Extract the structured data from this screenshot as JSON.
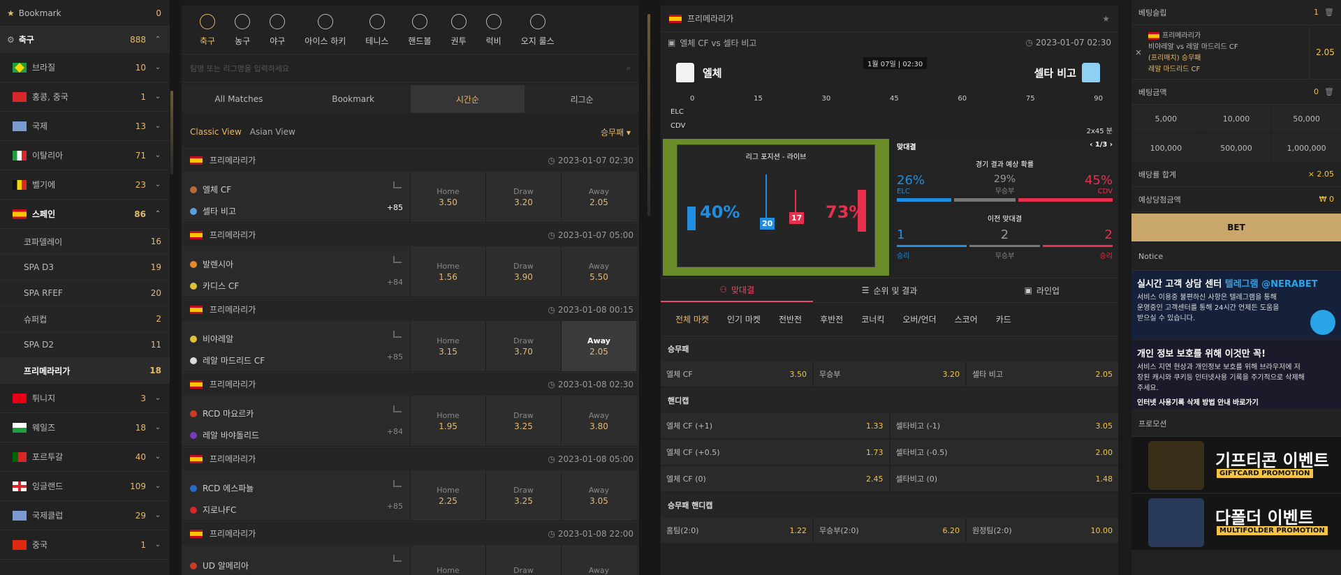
{
  "sidebar": {
    "bookmark": {
      "label": "Bookmark",
      "count": "0"
    },
    "soccer": {
      "label": "축구",
      "count": "888"
    },
    "countries": [
      {
        "label": "브라질",
        "count": "10"
      },
      {
        "label": "홍콩, 중국",
        "count": "1"
      },
      {
        "label": "국제",
        "count": "13"
      },
      {
        "label": "이탈리아",
        "count": "71"
      },
      {
        "label": "벨기에",
        "count": "23"
      },
      {
        "label": "스페인",
        "count": "86"
      }
    ],
    "spain_leagues": [
      {
        "label": "코파델레이",
        "count": "16"
      },
      {
        "label": "SPA D3",
        "count": "19"
      },
      {
        "label": "SPA RFEF",
        "count": "20"
      },
      {
        "label": "슈퍼컵",
        "count": "2"
      },
      {
        "label": "SPA D2",
        "count": "11"
      },
      {
        "label": "프리메라리가",
        "count": "18"
      }
    ],
    "countries2": [
      {
        "label": "튀니지",
        "count": "3"
      },
      {
        "label": "웨일즈",
        "count": "18"
      },
      {
        "label": "포르투갈",
        "count": "40"
      },
      {
        "label": "잉글랜드",
        "count": "109"
      },
      {
        "label": "국제클럽",
        "count": "29"
      },
      {
        "label": "중국",
        "count": "1"
      }
    ]
  },
  "sports": [
    "축구",
    "농구",
    "야구",
    "아이스 하키",
    "테니스",
    "핸드볼",
    "권투",
    "럭비",
    "오지 룰스"
  ],
  "search": {
    "placeholder": "팀명 또는 리그명을 입력하세요"
  },
  "tabs": [
    "All Matches",
    "Bookmark",
    "시간순",
    "리그순"
  ],
  "view": {
    "classic": "Classic View",
    "asian": "Asian View",
    "market": "승무패"
  },
  "odds_labels": {
    "home": "Home",
    "draw": "Draw",
    "away": "Away"
  },
  "matches": [
    {
      "league": "프리메라리가",
      "date": "2023-01-07 02:30",
      "home": "엘체 CF",
      "away": "셀타 비고",
      "more": "+85",
      "h": "3.50",
      "d": "3.20",
      "a": "2.05"
    },
    {
      "league": "프리메라리가",
      "date": "2023-01-07 05:00",
      "home": "발렌시아",
      "away": "카디스 CF",
      "more": "+84",
      "h": "1.56",
      "d": "3.90",
      "a": "5.50"
    },
    {
      "league": "프리메라리가",
      "date": "2023-01-08 00:15",
      "home": "비야레알",
      "away": "레알 마드리드 CF",
      "more": "+85",
      "h": "3.15",
      "d": "3.70",
      "a": "2.05"
    },
    {
      "league": "프리메라리가",
      "date": "2023-01-08 02:30",
      "home": "RCD 마요르카",
      "away": "레알 바야돌리드",
      "more": "+84",
      "h": "1.95",
      "d": "3.25",
      "a": "3.80"
    },
    {
      "league": "프리메라리가",
      "date": "2023-01-08 05:00",
      "home": "RCD 에스파뇰",
      "away": "지로나FC",
      "more": "+85",
      "h": "2.25",
      "d": "3.25",
      "a": "3.05"
    },
    {
      "league": "프리메라리가",
      "date": "2023-01-08 22:00",
      "home": "UD 알메리아",
      "away": "",
      "more": "",
      "h": "",
      "d": "",
      "a": ""
    }
  ],
  "detail": {
    "league": "프리메라리가",
    "fixture": "엘체 CF vs 셀타 비고",
    "date": "2023-01-07 02:30",
    "home": "엘체",
    "away": "셀타 비고",
    "kickoff": "1월 07일 | 02:30",
    "timeline_ticks": [
      "0",
      "15",
      "30",
      "45",
      "60",
      "75",
      "90"
    ],
    "elc": "ELC",
    "cdv": "CDV",
    "duration": "2x45 분",
    "live_title": "리그 포지션 - 라이브",
    "home_pct": "40%",
    "away_pct": "73%",
    "home_pos": "20",
    "away_pos": "17",
    "h2h_label": "맞대결",
    "h2h_page": "1/3",
    "prob_title": "경기 결과 예상 확률",
    "prob_home": "26%",
    "prob_draw": "29%",
    "prob_draw_label": "무승부",
    "prob_away": "45%",
    "prev_title": "이전 맞대결",
    "prev_home": "1",
    "prev_draw": "2",
    "prev_away": "2",
    "prev_home_label": "승리",
    "prev_draw_label": "무승부",
    "prev_away_label": "승리",
    "dtabs": [
      "맞대결",
      "순위 및 결과",
      "라인업"
    ],
    "markets": [
      "전체 마켓",
      "인기 마켓",
      "전반전",
      "후반전",
      "코너킥",
      "오버/언더",
      "스코어",
      "카드"
    ],
    "sec1": "승무패",
    "r1": [
      [
        "엘체 CF",
        "3.50"
      ],
      [
        "무승부",
        "3.20"
      ],
      [
        "셀타 비고",
        "2.05"
      ]
    ],
    "sec2": "핸디캡",
    "r2": [
      [
        "엘체 CF (+1)",
        "1.33"
      ],
      [
        "셀타비고 (-1)",
        "3.05"
      ]
    ],
    "r3": [
      [
        "엘체 CF (+0.5)",
        "1.73"
      ],
      [
        "셀타비고 (-0.5)",
        "2.00"
      ]
    ],
    "r4": [
      [
        "엘체 CF (0)",
        "2.45"
      ],
      [
        "셀타비고 (0)",
        "1.48"
      ]
    ],
    "sec3": "승무패 핸디캡",
    "r5": [
      [
        "홈팀(2:0)",
        "1.22"
      ],
      [
        "무승부(2:0)",
        "6.20"
      ],
      [
        "원정팀(2:0)",
        "10.00"
      ]
    ]
  },
  "betslip": {
    "title": "베팅슬립",
    "count": "1",
    "league": "프리메라리가",
    "fixture": "비야레알 vs 레알 마드리드 CF",
    "market": "(프리매치) 승무패",
    "pick": "레알 마드리드 CF",
    "odd": "2.05",
    "amount_label": "베팅금액",
    "amount": "0",
    "amounts": [
      "5,000",
      "10,000",
      "50,000",
      "100,000",
      "500,000",
      "1,000,000"
    ],
    "total_odds_label": "배당률 합계",
    "total_odds": "× 2.05",
    "expected_label": "예상당첨금액",
    "expected": "₩ 0",
    "bet": "BET",
    "notice": "Notice",
    "banner1_title": "실시간 고객 상담 센터",
    "banner1_hl": "텔레그램 @NERABET",
    "banner1_desc": "서비스 이용중 불편하신 사항은 텔레그램을 통해 운영중인 고객센터를 통해 24시간 언제든 도움을 받으실 수 있습니다.",
    "banner2_title": "개인 정보 보호를 위해 이것만 꼭!",
    "banner2_desc": "서비스 지연 현상과 개인정보 보호를 위해 브라우저에 저장된 캐시와 쿠키등 인터넷사용 기록을 주기적으로 삭제해 주세요.",
    "banner2_link": "인터넷 사용기록 삭제 방법 안내 바로가기",
    "promo_label": "프로모션",
    "promo1": "기프티콘 이벤트",
    "promo1_sub": "GIFTCARD PROMOTION",
    "promo2": "다폴더 이벤트",
    "promo2_sub": "MULTIFOLDER PROMOTION"
  }
}
